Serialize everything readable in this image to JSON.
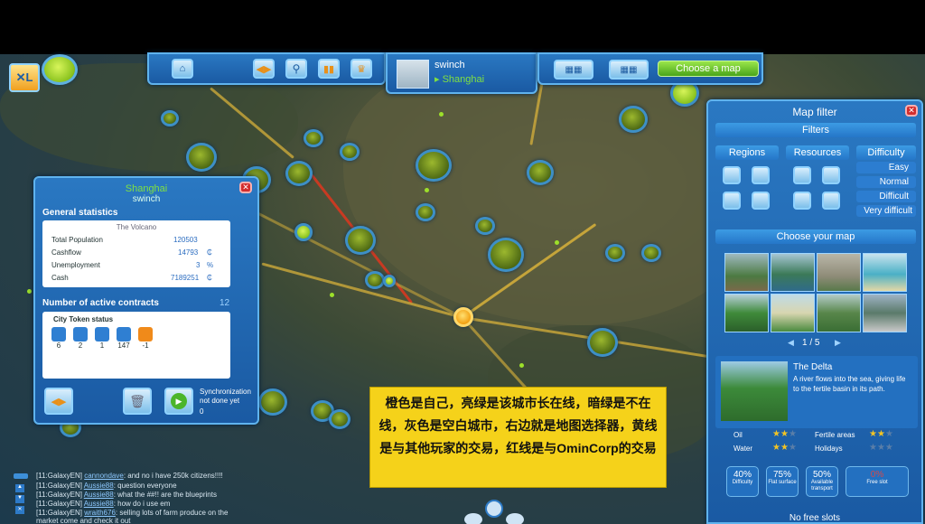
{
  "top": {
    "player_name": "swinch",
    "city_name": "Shanghai",
    "map_button": "Choose a map"
  },
  "city_panel": {
    "title": "Shanghai",
    "subtitle": "swinch",
    "general_stats_label": "General statistics",
    "scenario": "The Volcano",
    "stats": [
      {
        "label": "Total Population",
        "value": "120503",
        "unit": ""
      },
      {
        "label": "Cashflow",
        "value": "14793",
        "unit": "₵"
      },
      {
        "label": "Unemployment",
        "value": "3",
        "unit": "%"
      },
      {
        "label": "Cash",
        "value": "7189251",
        "unit": "₵"
      }
    ],
    "contracts_label": "Number of active contracts",
    "contracts_count": "12",
    "token_label": "City Token status",
    "tokens": [
      "6",
      "2",
      "1",
      "147",
      "-1"
    ],
    "sync_label": "Synchronization not done yet",
    "sync_value": "0"
  },
  "map_filter": {
    "title": "Map filter",
    "filters_label": "Filters",
    "regions_label": "Regions",
    "resources_label": "Resources",
    "difficulty_label": "Difficulty",
    "difficulty_options": [
      "Easy",
      "Normal",
      "Difficult",
      "Very difficult"
    ],
    "choose_map_label": "Choose your map",
    "page": "1 / 5",
    "selected_map": {
      "name": "The Delta",
      "description": "A river flows into the sea, giving life to the fertile basin in its path."
    },
    "resources": [
      {
        "label": "Oil",
        "stars": 2
      },
      {
        "label": "Fertile areas",
        "stars": 2
      },
      {
        "label": "Water",
        "stars": 2
      },
      {
        "label": "Holidays",
        "stars": 0
      }
    ],
    "stats": [
      {
        "value": "40%",
        "label": "Difficulty"
      },
      {
        "value": "75%",
        "label": "Flat surface"
      },
      {
        "value": "50%",
        "label": "Available transport"
      },
      {
        "value": "0%",
        "label": "Free slot"
      }
    ],
    "footer": "No free slots"
  },
  "annotation": {
    "text": "橙色是自己，亮绿是该城市长在线，暗绿是不在线，灰色是空白城市，右边就是地图选择器，黄线是与其他玩家的交易，红线是与OminCorp的交易"
  },
  "chat": [
    {
      "channel": "[11:GalaxyEN]",
      "user": "cannondave",
      "msg": ": and no i have 250k citizens!!!!"
    },
    {
      "channel": "[11:GalaxyEN]",
      "user": "Aussie88",
      "msg": ": question everyone"
    },
    {
      "channel": "[11:GalaxyEN]",
      "user": "Aussie88",
      "msg": ": what the ##!! are the blueprints"
    },
    {
      "channel": "[11:GalaxyEN]",
      "user": "Aussie88",
      "msg": ": how do i use em"
    },
    {
      "channel": "[11:GalaxyEN]",
      "user": "wraith676",
      "msg": ": selling lots of farm produce on the market come and check it out"
    }
  ],
  "colors": {
    "panel": "#1f66b0",
    "accent_green": "#6cc62a",
    "annotation_bg": "#f5d21a",
    "own_city": "#f2a012"
  }
}
